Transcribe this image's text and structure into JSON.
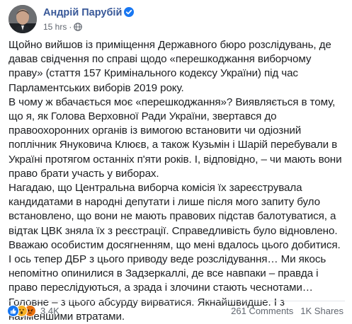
{
  "author": {
    "name": "Андрій Парубій",
    "timestamp": "15 hrs",
    "separator": "·",
    "avatar_icon": "profile-photo",
    "verified_icon": "verified-badge-icon",
    "privacy_icon": "globe-icon"
  },
  "post": {
    "paragraphs": [
      "Щойно вийшов із приміщення Державного бюро розслідувань, де давав свідчення по справі щодо «перешкоджання виборчому праву» (стаття 157 Кримінального кодексу України) під час Парламентських виборів 2019 року.",
      "В чому ж вбачається моє «перешкоджання»? Виявляється в тому, що я, як Голова Верховної Ради України, звертався до правоохоронних органів із вимогою встановити чи одіозний поплічник Януковича Клюєв, а також Кузьмін і Шарій перебували в Україні протягом останніх п'яти років. І, відповідно, – чи мають вони право брати участь у виборах.",
      "Нагадаю, що Центральна виборча комісія їх зареєструвала кандидатами в народні депутати і лише після мого запиту було встановлено, що вони не мають правових підстав балотуватися, а відтак ЦВК зняла їх з реєстрації. Справедливість було відновлено.",
      "Вважаю особистим досягненням, що мені вдалось цього добитися.",
      "І ось тепер ДБР з цього приводу веде розслідування… Ми якось непомітно опинилися в Задзеркаллі, де все навпаки – правда і право переслідуються, а зрада і злочини стають чеснотами… Головне – з цього абсурду вирватися. Якнайшвидше. І з найменшими втратами."
    ]
  },
  "footer": {
    "reactions": [
      "like",
      "wow",
      "angry"
    ],
    "reaction_count": "3.4K",
    "comments": "261 Comments",
    "shares": "1K Shares"
  },
  "colors": {
    "author_link": "#385898",
    "meta_gray": "#616770",
    "like_blue": "#1877f2",
    "wow_yellow": "#f7b125",
    "angry_orange": "#e9710f"
  }
}
